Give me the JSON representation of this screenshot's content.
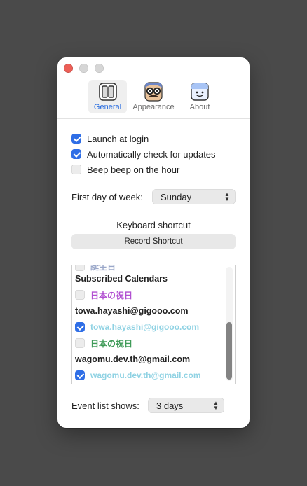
{
  "colors": {
    "accent": "#2f6ee6",
    "holiday_purple": "#b14fd1",
    "holiday_green": "#3f9b58",
    "calendar_cyan": "#8fd2e3",
    "close_red": "#ec5f57"
  },
  "toolbar": {
    "tabs": [
      {
        "label": "General",
        "icon": "general-icon",
        "selected": true
      },
      {
        "label": "Appearance",
        "icon": "appearance-icon",
        "selected": false
      },
      {
        "label": "About",
        "icon": "about-icon",
        "selected": false
      }
    ]
  },
  "options": [
    {
      "label": "Launch at login",
      "checked": true
    },
    {
      "label": "Automatically check for updates",
      "checked": true
    },
    {
      "label": "Beep beep on the hour",
      "checked": false
    }
  ],
  "first_day": {
    "label": "First day of week:",
    "value": "Sunday"
  },
  "shortcut": {
    "title": "Keyboard shortcut",
    "button": "Record Shortcut"
  },
  "calendars": {
    "items": [
      {
        "type": "calendar",
        "label": "誕生日",
        "checked": false,
        "color": "#9aa7c9"
      },
      {
        "type": "header",
        "label": "Subscribed Calendars"
      },
      {
        "type": "calendar",
        "label": "日本の祝日",
        "checked": false,
        "color": "#b14fd1"
      },
      {
        "type": "header",
        "label": "towa.hayashi@gigooo.com"
      },
      {
        "type": "calendar",
        "label": "towa.hayashi@gigooo.com",
        "checked": true,
        "color": "#8fd2e3"
      },
      {
        "type": "calendar",
        "label": "日本の祝日",
        "checked": false,
        "color": "#3f9b58"
      },
      {
        "type": "header",
        "label": "wagomu.dev.th@gmail.com"
      },
      {
        "type": "calendar",
        "label": "wagomu.dev.th@gmail.com",
        "checked": true,
        "color": "#8fd2e3"
      }
    ]
  },
  "event_list": {
    "label": "Event list shows:",
    "value": "3 days"
  }
}
